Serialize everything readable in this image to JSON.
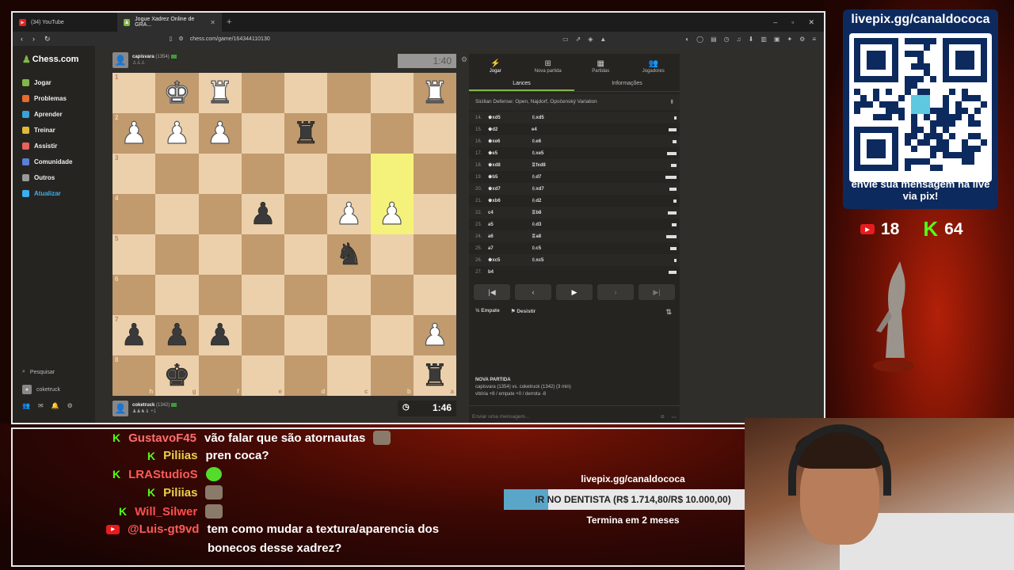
{
  "browser": {
    "tabs": [
      {
        "label": "(34) YouTube",
        "color": "#e81c1c",
        "fav": "▶"
      },
      {
        "label": "Jogue Xadrez Online de GRA...",
        "color": "#81b64c",
        "fav": "♟",
        "active": true
      }
    ],
    "url": "chess.com/game/164344110130"
  },
  "sidebar": {
    "logo": "Chess.com",
    "items": [
      {
        "label": "Jogar",
        "color": "#81b64c"
      },
      {
        "label": "Problemas",
        "color": "#e56b2f"
      },
      {
        "label": "Aprender",
        "color": "#3aa3d6"
      },
      {
        "label": "Treinar",
        "color": "#e0b93a"
      },
      {
        "label": "Assistir",
        "color": "#e8625b"
      },
      {
        "label": "Comunidade",
        "color": "#5a7fd6"
      },
      {
        "label": "Outros",
        "color": "#999999"
      },
      {
        "label": "Atualizar",
        "color": "#3ab0f0",
        "accent": true
      }
    ],
    "search": "Pesquisar",
    "user": "coketruck"
  },
  "top_player": {
    "name": "capisvara",
    "rating": "(1354)",
    "clock": "1:40"
  },
  "bottom_player": {
    "name": "coketruck",
    "rating": "(1342)",
    "caps": "♟♟♞♝ +1",
    "clock": "1:46"
  },
  "board": {
    "ranks": [
      "1",
      "2",
      "3",
      "4",
      "5",
      "6",
      "7",
      "8"
    ],
    "files": [
      "h",
      "g",
      "f",
      "e",
      "d",
      "c",
      "b",
      "a"
    ],
    "highlight": [
      [
        2,
        6
      ],
      [
        3,
        6
      ]
    ],
    "pieces": {
      "0,1": "wk",
      "0,2": "wr",
      "0,7": "wr",
      "1,0": "wp",
      "1,1": "wp",
      "1,2": "wp",
      "1,4": "br",
      "3,3": "bp",
      "3,5": "wp",
      "3,6": "wp",
      "4,5": "bn",
      "6,0": "bp",
      "6,1": "bp",
      "6,2": "bp",
      "6,7": "wp",
      "7,1": "bk",
      "7,7": "br"
    }
  },
  "panel": {
    "tabs": [
      {
        "label": "Jogar",
        "icon": "⚡"
      },
      {
        "label": "Nova partida",
        "icon": "⊞"
      },
      {
        "label": "Partidas",
        "icon": "▦"
      },
      {
        "label": "Jogadores",
        "icon": "👥"
      }
    ],
    "subtabs": [
      "Lances",
      "Informações"
    ],
    "opening": "Sicilian Defense: Open, Najdorf, Opočenský Variation",
    "moves": [
      {
        "n": "14.",
        "w": "♚xd5",
        "b": "♘xd5"
      },
      {
        "n": "15.",
        "w": "♚d2",
        "b": "e4"
      },
      {
        "n": "16.",
        "w": "♚xe6",
        "b": "♘e6"
      },
      {
        "n": "17.",
        "w": "♚e5",
        "b": "♘xe5"
      },
      {
        "n": "18.",
        "w": "♚xd8",
        "b": "♖fxd8"
      },
      {
        "n": "19.",
        "w": "♚b5",
        "b": "♘d7"
      },
      {
        "n": "20.",
        "w": "♚xd7",
        "b": "♘xd7"
      },
      {
        "n": "21.",
        "w": "♚xb6",
        "b": "♘d2"
      },
      {
        "n": "22.",
        "w": "c4",
        "b": "♖b8"
      },
      {
        "n": "23.",
        "w": "a5",
        "b": "♘d3"
      },
      {
        "n": "24.",
        "w": "a6",
        "b": "♖a8"
      },
      {
        "n": "25.",
        "w": "a7",
        "b": "♘c5"
      },
      {
        "n": "26.",
        "w": "♚xc5",
        "b": "♘xc5"
      },
      {
        "n": "27.",
        "w": "b4",
        "b": ""
      }
    ],
    "draw": "Empate",
    "resign": "Desistir",
    "game_title": "NOVA PARTIDA",
    "game_line1": "capisvara (1354) vs. coketruck (1342) (3 min)",
    "game_line2": "vitória +8 / empate +0 / derrota -8",
    "message_placeholder": "Enviar uma mensagem..."
  },
  "overlay": {
    "qr_title": "livepix.gg/canaldococa",
    "qr_sub": "envie sua mensagem na live via pix!",
    "yt_count": "18",
    "kick_count": "64"
  },
  "chat": [
    {
      "plat": "k",
      "user": "GustavoF45",
      "color": "#ff6e6e",
      "text": "vão falar que são atornautas",
      "emote": true
    },
    {
      "plat": "k",
      "user": "Piliias",
      "color": "#e8d24a",
      "text": "pren coca?"
    },
    {
      "plat": "k",
      "user": "LRAStudioS",
      "color": "#ff5a5a",
      "text": "",
      "emote": "green"
    },
    {
      "plat": "k",
      "user": "Piliias",
      "color": "#e8d24a",
      "text": "",
      "emote": true
    },
    {
      "plat": "k",
      "user": "Will_Silwer",
      "color": "#ff4d4d",
      "text": "",
      "emote": true
    },
    {
      "plat": "y",
      "user": "@Luis-gt9vd",
      "color": "#ff5a5a",
      "text": "tem como mudar a textura/aparencia dos"
    },
    {
      "plat": "",
      "user": "",
      "color": "#ffffff",
      "text": "bonecos desse xadrez?"
    }
  ],
  "goal": {
    "title": "livepix.gg/canaldococa",
    "label": "IR NO DENTISTA (R$ 1.714,80/R$ 10.000,00)",
    "progress": 0.1715,
    "sub": "Termina em 2 meses"
  },
  "colors": {
    "accent": "#81b64c",
    "kick": "#53fc18",
    "youtube": "#e81c1c"
  }
}
